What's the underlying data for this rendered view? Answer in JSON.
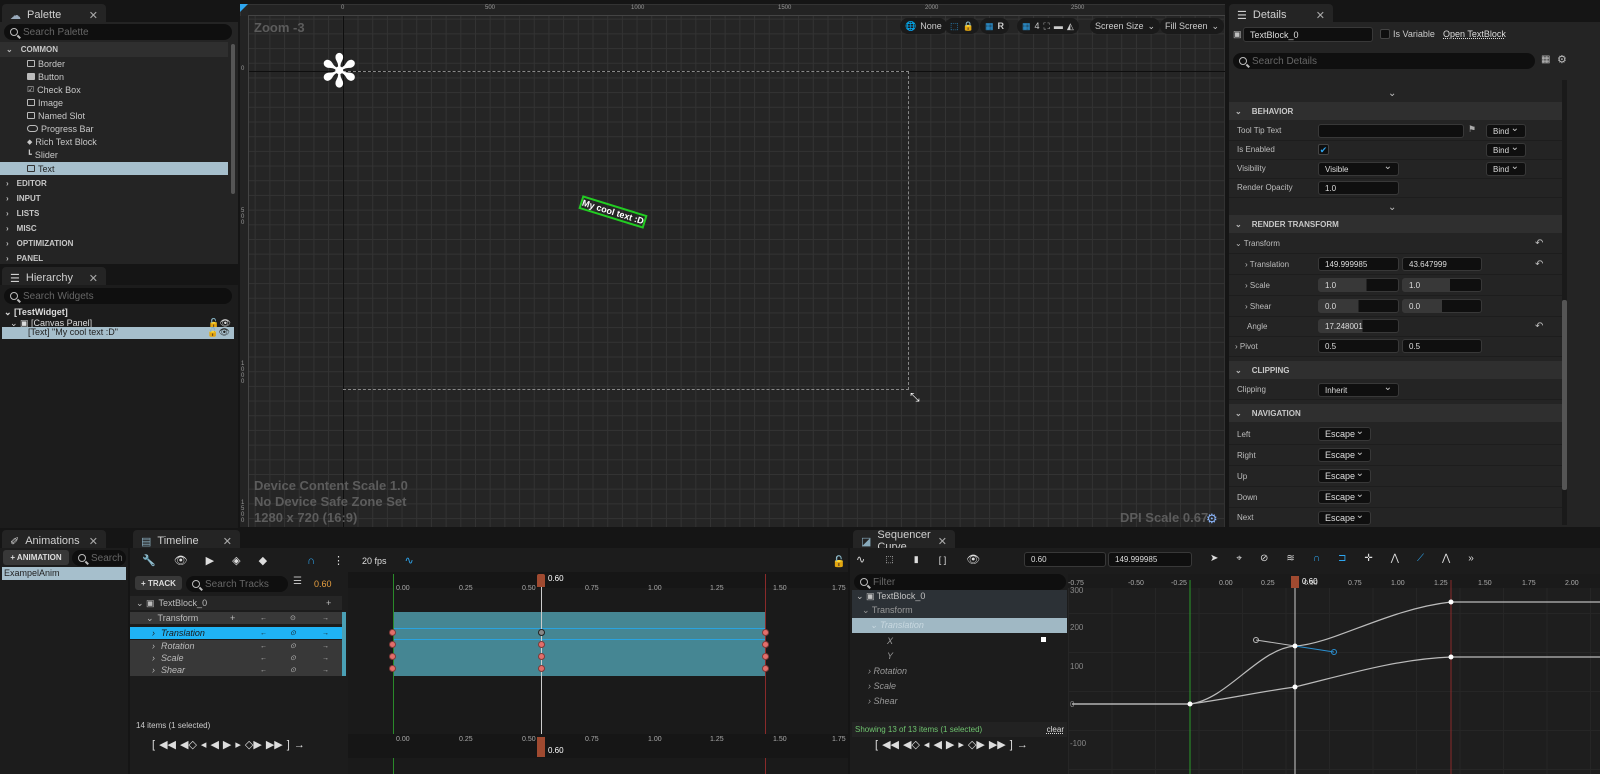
{
  "palette": {
    "tab_label": "Palette",
    "search_placeholder": "Search Palette",
    "categories": {
      "common": "COMMON",
      "editor": "EDITOR",
      "input": "INPUT",
      "lists": "LISTS",
      "misc": "MISC",
      "optimization": "OPTIMIZATION",
      "panel": "PANEL"
    },
    "items": [
      "Border",
      "Button",
      "Check Box",
      "Image",
      "Named Slot",
      "Progress Bar",
      "Rich Text Block",
      "Slider",
      "Text"
    ],
    "selected_item": "Text"
  },
  "hierarchy": {
    "tab_label": "Hierarchy",
    "search_placeholder": "Search Widgets",
    "root": "[TestWidget]",
    "canvas": "[Canvas Panel]",
    "text_node": "[Text] \"My cool text :D\""
  },
  "viewport": {
    "zoom_label": "Zoom -3",
    "ruler_top": [
      "0",
      "500",
      "1000",
      "1500",
      "2000",
      "2500"
    ],
    "ruler_left": [
      "0",
      "500",
      "1000",
      "1500"
    ],
    "widget_text": "My cool text :D",
    "device_scale": "Device Content Scale 1.0",
    "safe_zone": "No Device Safe Zone Set",
    "resolution": "1280 x 720 (16:9)",
    "dpi_scale": "DPI Scale 0.67",
    "toolbar": {
      "none_label": "None",
      "r_label": "R",
      "grid_value": "4",
      "screen_size": "Screen Size",
      "fill_screen": "Fill Screen"
    }
  },
  "details": {
    "tab_label": "Details",
    "name_value": "TextBlock_0",
    "is_variable_label": "Is Variable",
    "open_link": "Open TextBlock",
    "search_placeholder": "Search Details",
    "sections": {
      "behavior": "BEHAVIOR",
      "render_transform": "RENDER TRANSFORM",
      "clipping": "CLIPPING",
      "navigation": "NAVIGATION"
    },
    "behavior": {
      "tooltip_label": "Tool Tip Text",
      "tooltip_value": "",
      "enabled_label": "Is Enabled",
      "enabled": true,
      "visibility_label": "Visibility",
      "visibility_value": "Visible",
      "opacity_label": "Render Opacity",
      "opacity_value": "1.0",
      "bind_label": "Bind"
    },
    "transform": {
      "group_label": "Transform",
      "translation_label": "Translation",
      "translation_x": "149.999985",
      "translation_y": "43.647999",
      "scale_label": "Scale",
      "scale_x": "1.0",
      "scale_y": "1.0",
      "shear_label": "Shear",
      "shear_x": "0.0",
      "shear_y": "0.0",
      "angle_label": "Angle",
      "angle_value": "17.248001",
      "pivot_label": "Pivot",
      "pivot_x": "0.5",
      "pivot_y": "0.5"
    },
    "clipping": {
      "label": "Clipping",
      "value": "Inherit"
    },
    "navigation": [
      {
        "label": "Left",
        "value": "Escape"
      },
      {
        "label": "Right",
        "value": "Escape"
      },
      {
        "label": "Up",
        "value": "Escape"
      },
      {
        "label": "Down",
        "value": "Escape"
      },
      {
        "label": "Next",
        "value": "Escape"
      }
    ]
  },
  "animations": {
    "tab_label": "Animations",
    "add_button": "+ ANIMATION",
    "search_placeholder": "Search",
    "items": [
      "ExampelAnim"
    ]
  },
  "timeline": {
    "tab_label": "Timeline",
    "fps": "20 fps",
    "add_track": "+ TRACK",
    "search_placeholder": "Search Tracks",
    "current_time": "0.60",
    "tracks": {
      "object": "TextBlock_0",
      "transform": "Transform",
      "translation": "Translation",
      "rotation": "Rotation",
      "scale": "Scale",
      "shear": "Shear"
    },
    "ruler": [
      "0.00",
      "0.25",
      "0.50",
      "0.75",
      "1.00",
      "1.25",
      "1.50",
      "1.75"
    ],
    "status": "14 items (1 selected)",
    "playhead_label": "0.60"
  },
  "curve_editor": {
    "tab_label": "Sequencer Curve",
    "time_value": "0.60",
    "value_value": "149.999985",
    "filter_placeholder": "Filter",
    "tree": {
      "object": "TextBlock_0",
      "transform": "Transform",
      "translation": "Translation",
      "x": "X",
      "y": "Y",
      "rotation": "Rotation",
      "scale": "Scale",
      "shear": "Shear"
    },
    "status": "Showing 13 of 13 items (1 selected)",
    "clear_link": "clear",
    "ruler": [
      "-0.75",
      "-0.50",
      "-0.25",
      "0.00",
      "0.25",
      "0.50",
      "0.75",
      "1.00",
      "1.25",
      "1.50",
      "1.75",
      "2.00"
    ],
    "y_labels": [
      "300",
      "200",
      "100",
      "0",
      "-100"
    ],
    "playhead_label": "0.60"
  }
}
